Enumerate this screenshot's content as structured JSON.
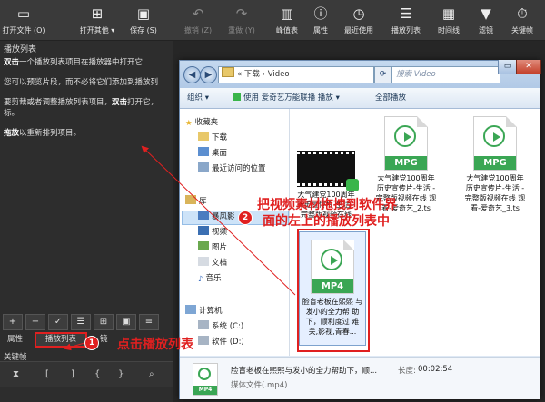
{
  "toolbar": {
    "items": [
      {
        "label": "打开文件 (O)",
        "icon": "open-file-icon",
        "glyph": "▭"
      },
      {
        "label": "打开其他",
        "icon": "open-other-icon",
        "glyph": "⊞"
      },
      {
        "label": "保存 (S)",
        "icon": "save-icon",
        "glyph": "💾"
      },
      {
        "label": "撤销 (Z)",
        "icon": "undo-icon",
        "glyph": "↶"
      },
      {
        "label": "重做 (Y)",
        "icon": "redo-icon",
        "glyph": "↷"
      },
      {
        "label": "峰值表",
        "icon": "peak-meter-icon",
        "glyph": "▥"
      },
      {
        "label": "属性",
        "icon": "properties-icon",
        "glyph": "ⓘ"
      },
      {
        "label": "最近使用",
        "icon": "recent-icon",
        "glyph": "◷"
      },
      {
        "label": "播放列表",
        "icon": "playlist-icon",
        "glyph": "☰"
      },
      {
        "label": "时间线",
        "icon": "timeline-icon",
        "glyph": "▦"
      },
      {
        "label": "滤镜",
        "icon": "filter-icon",
        "glyph": "▼"
      },
      {
        "label": "关键帧",
        "icon": "keyframe-icon",
        "glyph": "⏱"
      }
    ]
  },
  "playlist": {
    "title": "播放列表",
    "line1_bold": "双击",
    "line1_rest": "一个播放列表项目在播放器中打开它",
    "line2": "您可以预览片段，而不必将它们添加到播放列",
    "line3_pre": "要剪裁或者调整播放列表项目，",
    "line3_bold": "双击",
    "line3_rest": "打开它，",
    "line3b": "标。",
    "line4_bold": "拖放",
    "line4_rest": "以重新排列项目。",
    "tabs": {
      "properties": "属性",
      "playlist": "播放列表",
      "other": "镜"
    },
    "keyframes_label": "关键帧"
  },
  "explorer": {
    "path_prefix": "«",
    "path_1": "下载",
    "path_sep": "›",
    "path_2": "Video",
    "search_placeholder": "搜索 Video",
    "cmd": {
      "organize": "组织 ▾",
      "play": "使用 爱奇艺万能联播 播放 ▾",
      "playall": "全部播放"
    },
    "nav": {
      "favorites": "收藏夹",
      "downloads": "下载",
      "desktop": "桌面",
      "recent": "最近访问的位置",
      "libraries": "库",
      "tudou": "暴风影",
      "videos": "视频",
      "pictures": "图片",
      "documents": "文档",
      "music": "音乐",
      "computer": "计算机",
      "system_c": "系统 (C:)",
      "software_d": "软件 (D:)"
    },
    "files": [
      {
        "name": "大气建党100周年 历史宣传片-生活 -完整版视频在线",
        "badge": ""
      },
      {
        "name": "大气建党100周年 历史宣传片-生活 -完整版视频在线 观看-爱奇艺_2.ts",
        "badge": "MPG"
      },
      {
        "name": "大气建党100周年 历史宣传片-生活 -完整版视频在线 观看-爱奇艺_3.ts",
        "badge": "MPG"
      },
      {
        "name": "脸盲老板在熙熙 与发小的全力帮 助下，顺利度过 难关,影视,青春...",
        "badge": "MP4"
      }
    ],
    "detail": {
      "title": "脸盲老板在熙熙与发小的全力帮助下，顺...",
      "length_label": "长度:",
      "length": "00:02:54",
      "type": "媒体文件(.mp4)",
      "badge": "MP4"
    }
  },
  "annotations": {
    "step1_num": "1",
    "step1_text": "点击播放列表",
    "step2_num": "2",
    "step2_line1": "把视频素材拖拽到软件界",
    "step2_line2": "面的左上的播放列表中",
    "color": "#e02020"
  }
}
